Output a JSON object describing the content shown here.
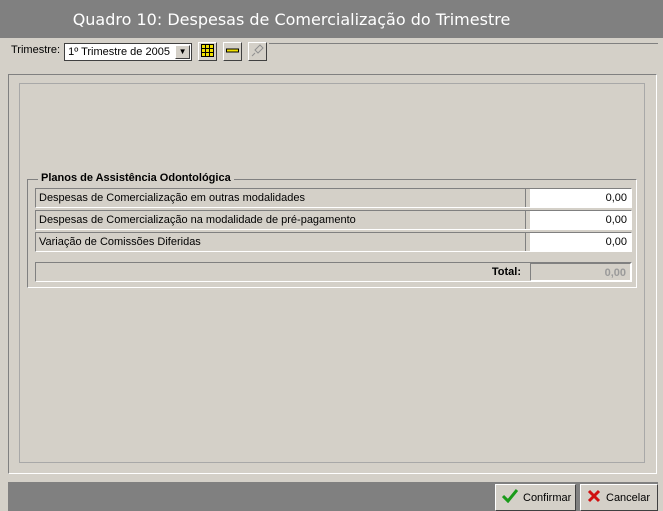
{
  "window": {
    "title": "Quadro 10: Despesas de Comercialização do Trimestre"
  },
  "toolbar": {
    "trimestre_label": "Trimestre:",
    "trimestre_value": "1º Trimestre de 2005",
    "buttons": [
      "grid-icon",
      "line-icon",
      "pin-icon"
    ]
  },
  "group": {
    "title": "Planos de Assistência Odontológica",
    "rows": [
      {
        "label": "Despesas de Comercialização em outras modalidades",
        "value": "0,00"
      },
      {
        "label": "Despesas de Comercialização na modalidade de pré-pagamento",
        "value": "0,00"
      },
      {
        "label": "Variação de Comissões Diferidas",
        "value": "0,00"
      }
    ],
    "total_label": "Total:",
    "total_value": "0,00"
  },
  "actions": {
    "confirm_label": "Confirmar",
    "cancel_label": "Cancelar"
  },
  "colors": {
    "titlebar": "#808080",
    "face": "#d4d0c8",
    "confirm_icon": "#1a9a1a",
    "cancel_icon": "#d01010"
  }
}
